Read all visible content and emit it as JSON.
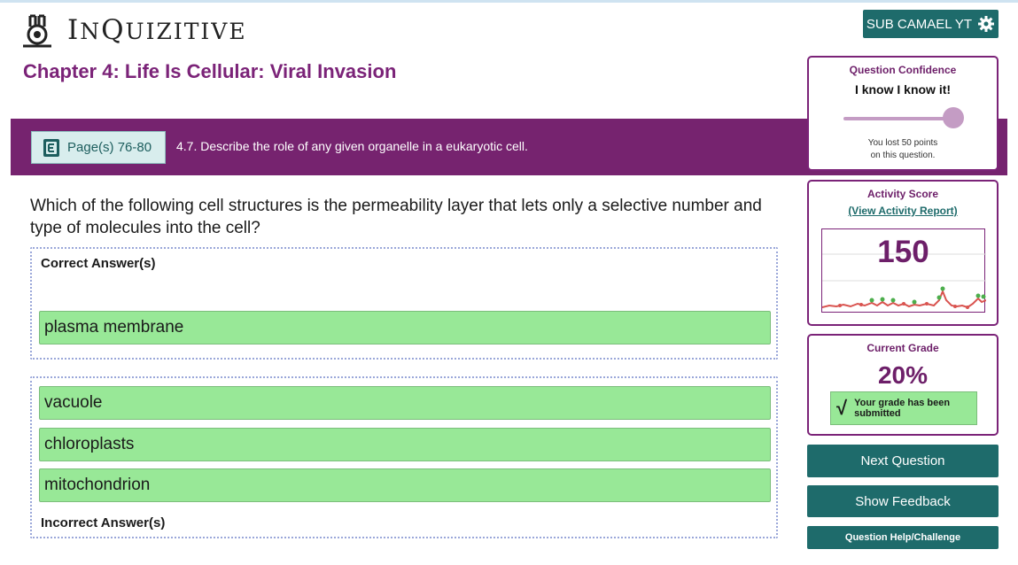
{
  "header": {
    "logo_text_parts": [
      "I",
      "N",
      "Q",
      "UIZITIVE"
    ],
    "user_button": "SUB CAMAEL YT"
  },
  "chapter": {
    "title": "Chapter 4: Life Is Cellular: Viral Invasion"
  },
  "band": {
    "pages_label": "Page(s) 76-80",
    "objective": "4.7. Describe the role of any given organelle in a eukaryotic cell."
  },
  "question": {
    "text": "Which of the following cell structures is the permeability layer that lets only a selective number and type of molecules into the cell?",
    "correct_label": "Correct Answer(s)",
    "incorrect_label": "Incorrect Answer(s)",
    "correct_answers": [
      "plasma membrane"
    ],
    "incorrect_answers": [
      "vacuole",
      "chloroplasts",
      "mitochondrion"
    ]
  },
  "confidence": {
    "title": "Question Confidence",
    "value": "I know I know it!",
    "slider_level": 1.0,
    "note_line1": "You lost 50 points",
    "note_line2": "on this question."
  },
  "activity": {
    "title": "Activity Score",
    "report_link": "(View Activity Report)",
    "score": "150"
  },
  "grade": {
    "title": "Current Grade",
    "value": "20%",
    "submitted_text": "Your grade has been submitted",
    "check_glyph": "√"
  },
  "actions": {
    "next": "Next Question",
    "feedback": "Show Feedback",
    "help": "Question Help/Challenge"
  },
  "colors": {
    "brand_purple": "#7b2378",
    "teal": "#1e6b6b",
    "answer_green": "#98e897"
  },
  "icons": [
    "inquizitive-bunny-logo-icon",
    "gear-icon",
    "ebook-icon",
    "checkmark-icon"
  ]
}
